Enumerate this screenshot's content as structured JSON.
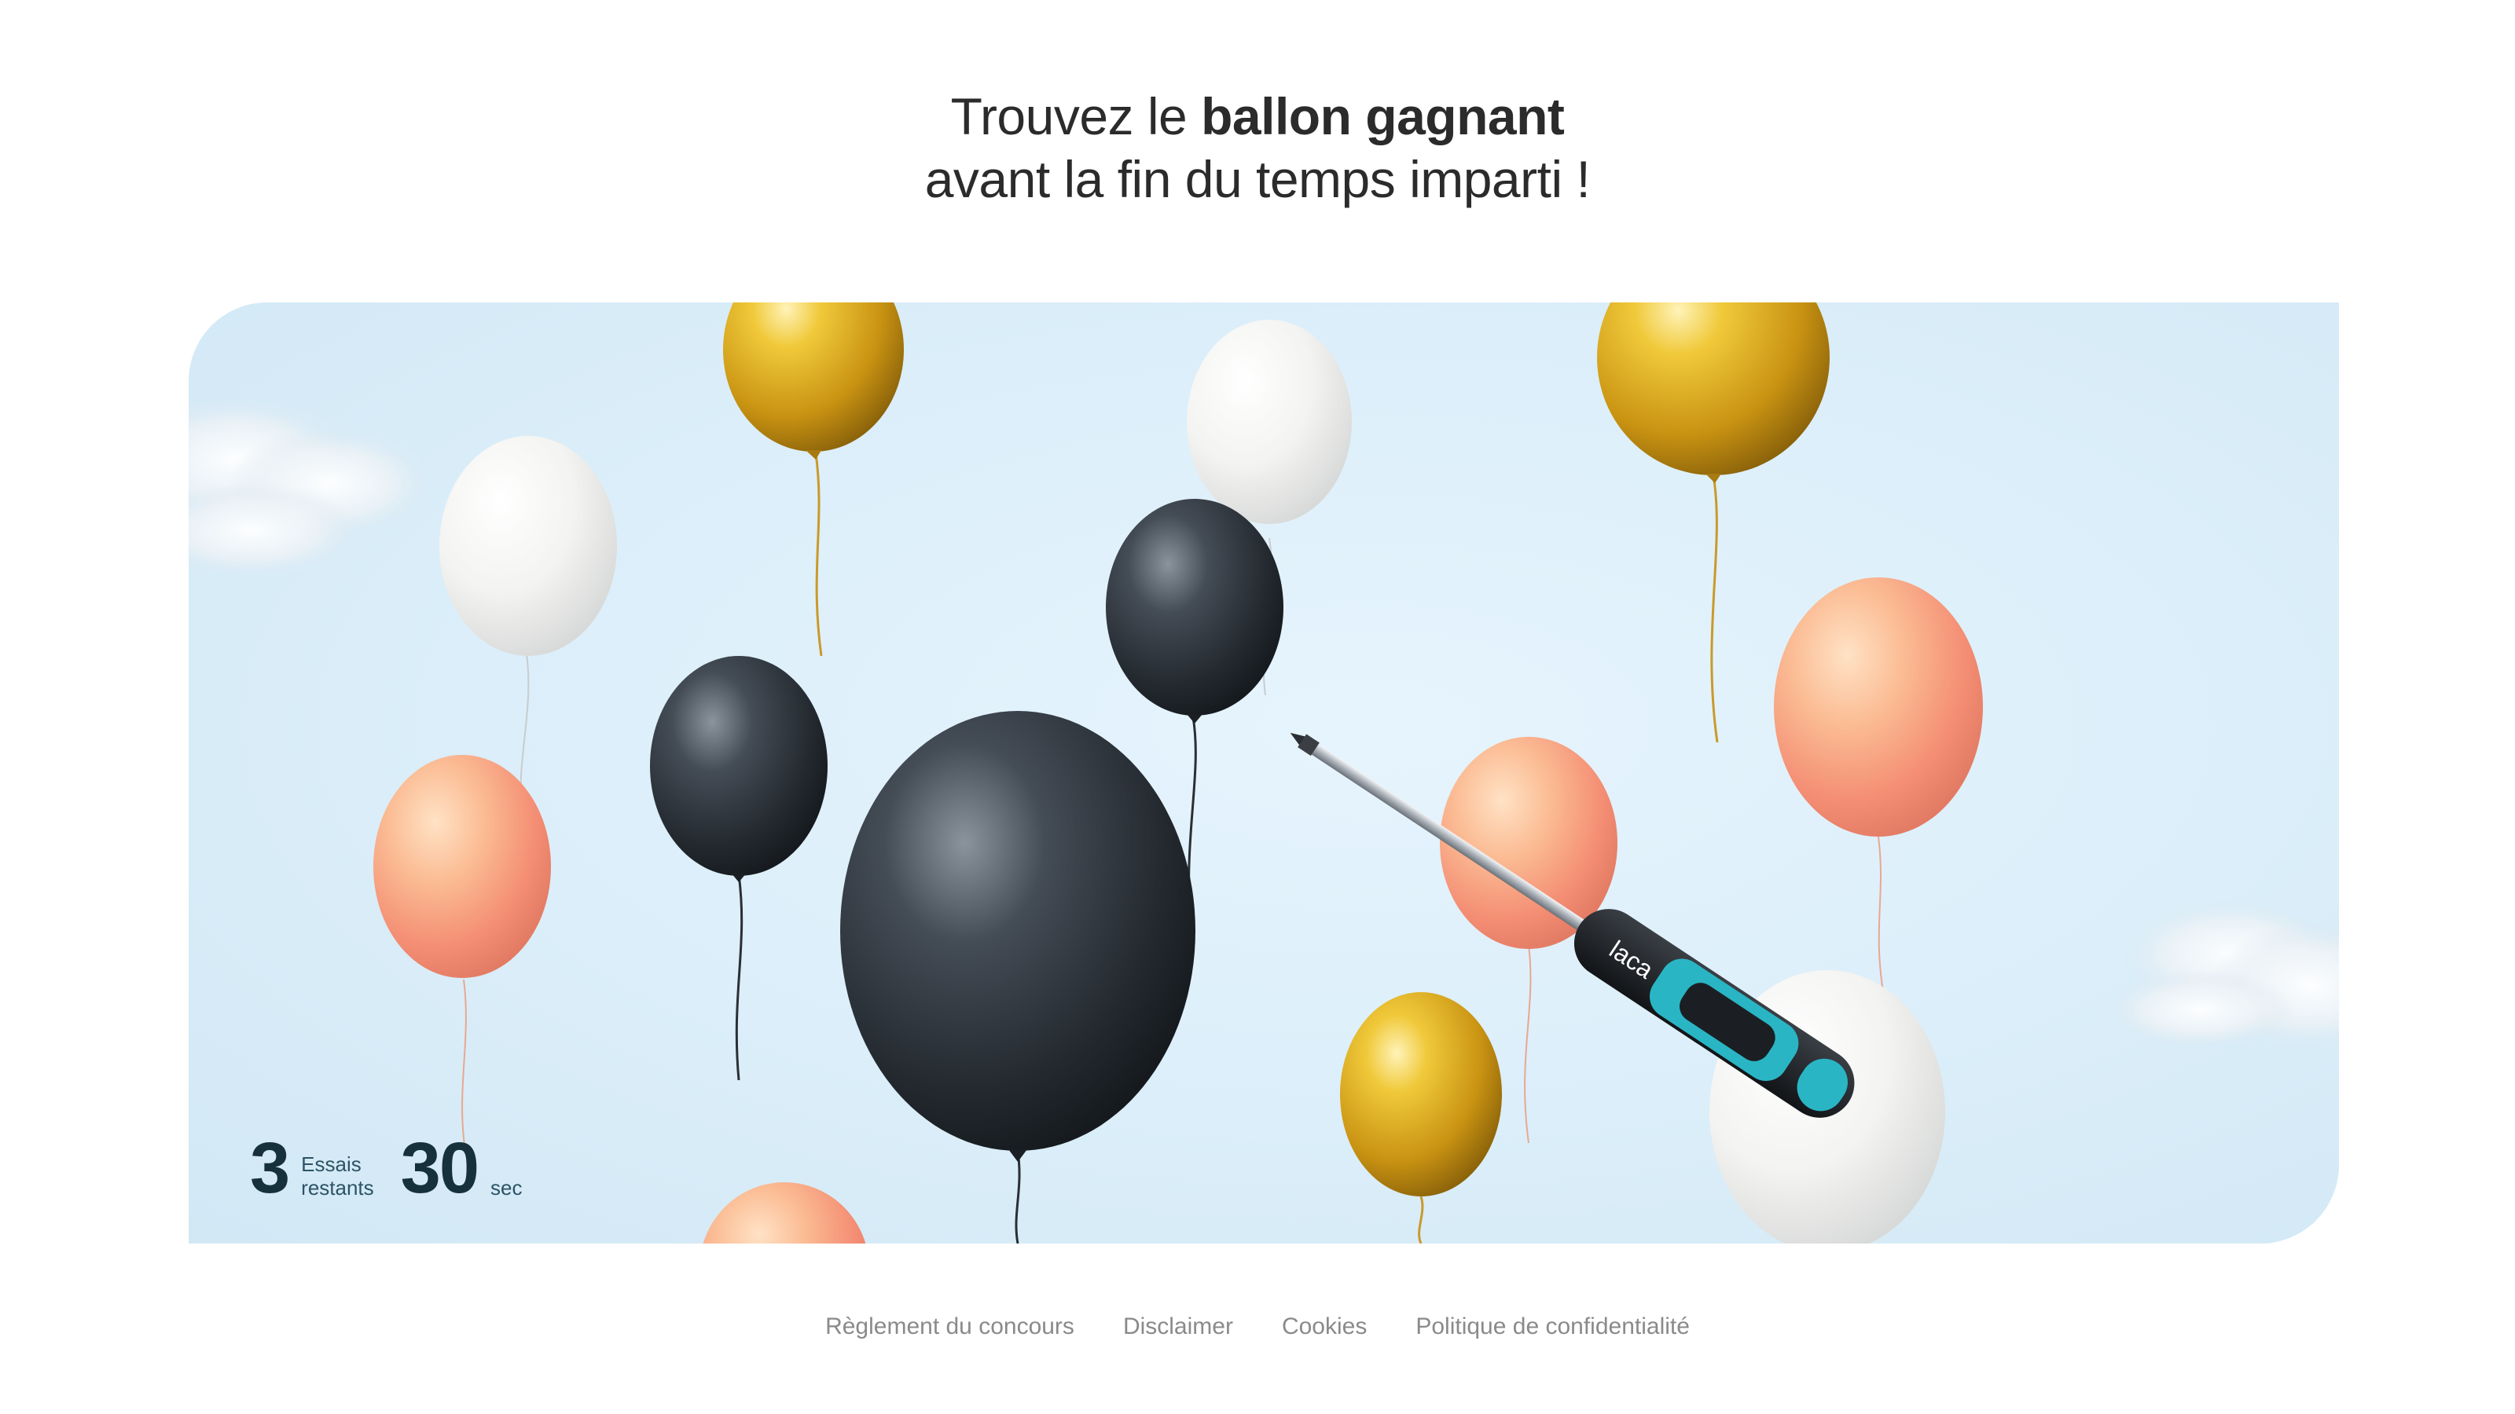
{
  "headline": {
    "line1_prefix": "Trouvez le ",
    "line1_bold": "ballon gagnant",
    "line2": "avant la fin du temps imparti !"
  },
  "counter": {
    "tries_value": "3",
    "tries_label_1": "Essais",
    "tries_label_2": "restants",
    "time_value": "30",
    "time_unit": "sec"
  },
  "tool": {
    "icon": "screwdriver-icon",
    "brand": "laca"
  },
  "balloons": [
    {
      "color": "gold",
      "name": "balloon-gold-1"
    },
    {
      "color": "white",
      "name": "balloon-white-1"
    },
    {
      "color": "white",
      "name": "balloon-white-2"
    },
    {
      "color": "gold",
      "name": "balloon-gold-2"
    },
    {
      "color": "black",
      "name": "balloon-black-1"
    },
    {
      "color": "black",
      "name": "balloon-black-2"
    },
    {
      "color": "black",
      "name": "balloon-black-3"
    },
    {
      "color": "peach",
      "name": "balloon-peach-1"
    },
    {
      "color": "peach",
      "name": "balloon-peach-2"
    },
    {
      "color": "peach",
      "name": "balloon-peach-3"
    },
    {
      "color": "gold",
      "name": "balloon-gold-3"
    },
    {
      "color": "white",
      "name": "balloon-white-3"
    },
    {
      "color": "peach",
      "name": "balloon-peach-4"
    }
  ],
  "colors": {
    "sky": "#dbeef9",
    "gold": "#e2b21e",
    "black": "#2b323b",
    "peach": "#f7a184",
    "white": "#f4f4f2",
    "accent": "#2ab5c4",
    "text_dark": "#16303c"
  },
  "footer": {
    "links": [
      "Règlement du concours",
      "Disclaimer",
      "Cookies",
      "Politique de confidentialité"
    ]
  }
}
